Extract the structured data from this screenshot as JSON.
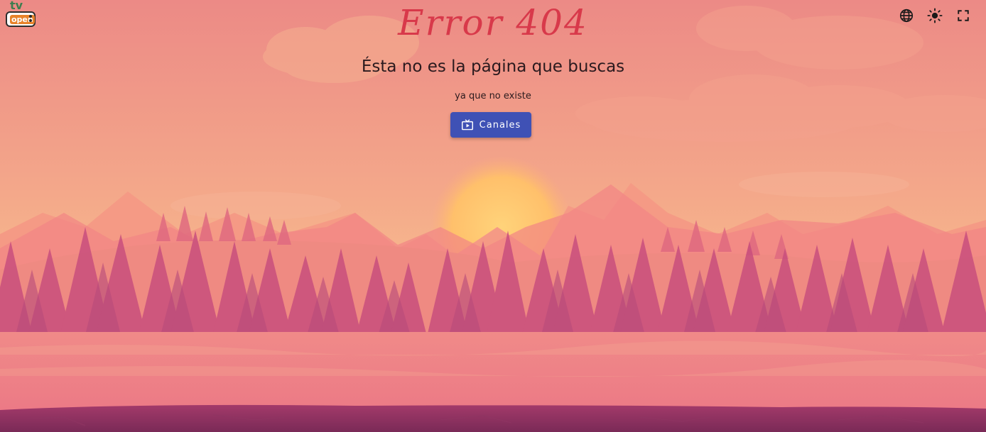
{
  "header": {
    "logo_text_top": "tv",
    "logo_text_box": "open"
  },
  "toolbar": {
    "language_icon": "globe-icon",
    "theme_icon": "sun-icon",
    "fullscreen_icon": "fullscreen-icon"
  },
  "main": {
    "title": "Error 404",
    "subtitle": "Ésta no es la página que buscas",
    "description": "ya que no existe",
    "button_label": "Canales",
    "button_icon": "tv-play-icon"
  },
  "colors": {
    "title": "#d8394a",
    "button": "#3f51b5",
    "sky_top": "#ec8a86",
    "sky_bottom": "#f6b48c"
  }
}
